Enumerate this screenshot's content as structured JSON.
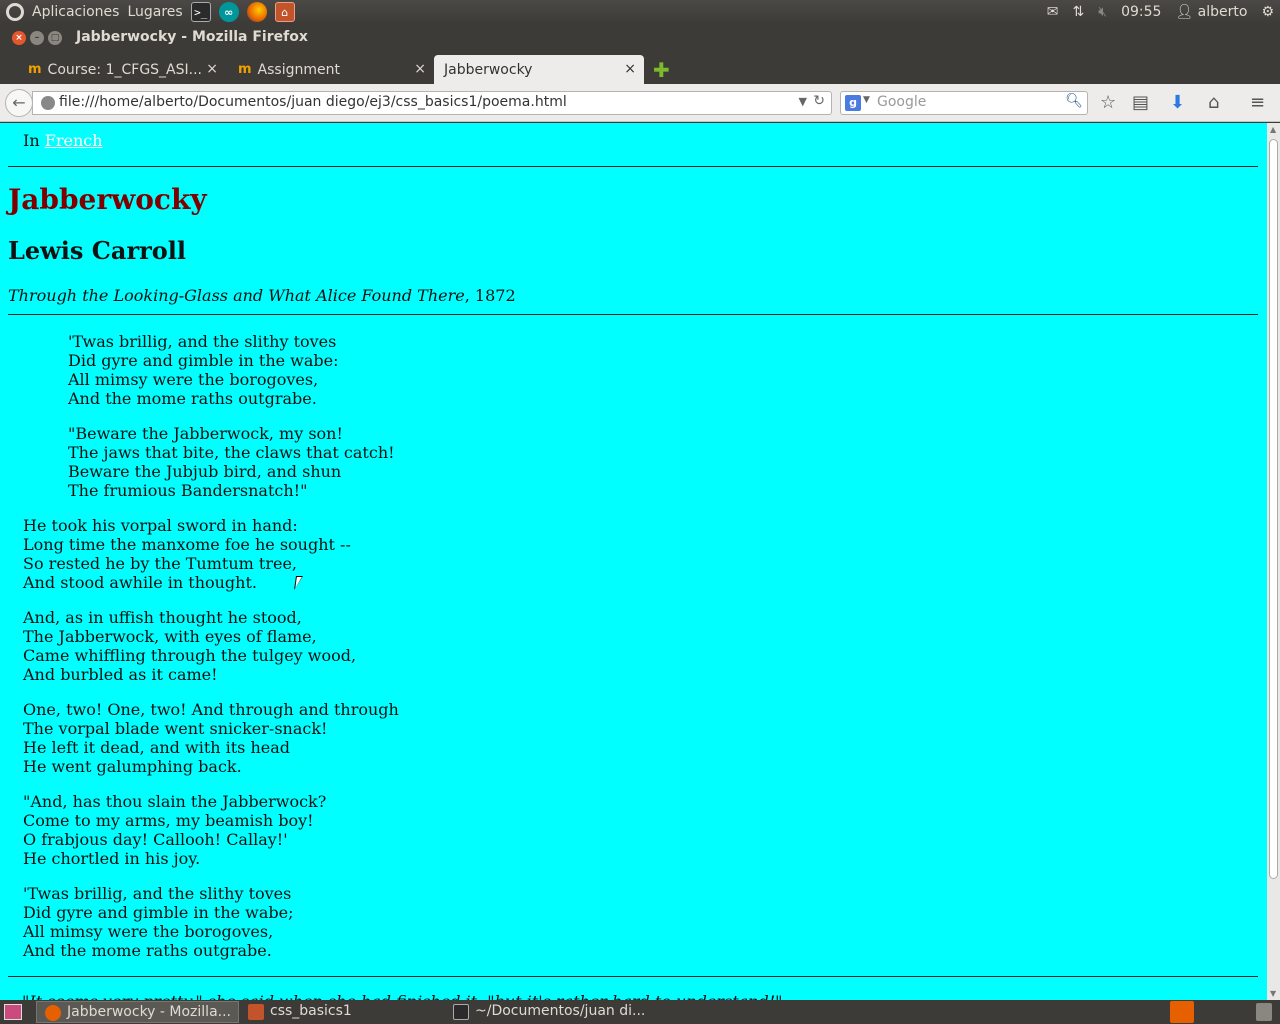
{
  "panel": {
    "menu_apps": "Aplicaciones",
    "menu_places": "Lugares",
    "clock": "09:55",
    "user": "alberto",
    "icons": [
      "terminal-icon",
      "arduino-icon",
      "firefox-icon",
      "home-folder-icon",
      "mail-icon",
      "network-icon",
      "volume-muted-icon",
      "user-icon",
      "gear-icon"
    ]
  },
  "window": {
    "title": "Jabberwocky - Mozilla Firefox"
  },
  "tabs": [
    {
      "label": "Course: 1_CFGS_ASI...",
      "active": false
    },
    {
      "label": "Assignment",
      "active": false
    },
    {
      "label": "Jabberwocky",
      "active": true
    }
  ],
  "tab_close": "×",
  "navbar": {
    "url": "file:///home/alberto/Documentos/juan diego/ej3/css_basics1/poema.html",
    "search_placeholder": "Google",
    "search_engine": "g"
  },
  "page": {
    "lang_prefix": "In",
    "lang_link": "French",
    "title": "Jabberwocky",
    "author": "Lewis Carroll",
    "source_italic": "Through the Looking-Glass and What Alice Found There",
    "source_year": ", 1872",
    "stanzas": [
      [
        "'Twas brillig, and the slithy toves",
        "Did gyre and gimble in the wabe:",
        "All mimsy were the borogoves,",
        "And the mome raths outgrabe."
      ],
      [
        "\"Beware the Jabberwock, my son!",
        "The jaws that bite, the claws that catch!",
        "Beware the Jubjub bird, and shun",
        "The frumious Bandersnatch!\""
      ],
      [
        "He took his vorpal sword in hand:",
        "Long time the manxome foe he sought --",
        "So rested he by the Tumtum tree,",
        "And stood awhile in thought."
      ],
      [
        "And, as in uffish thought he stood,",
        "The Jabberwock, with eyes of flame,",
        "Came whiffling through the tulgey wood,",
        "And burbled as it came!"
      ],
      [
        "One, two! One, two! And through and through",
        "The vorpal blade went snicker-snack!",
        "He left it dead, and with its head",
        "He went galumphing back."
      ],
      [
        "\"And, has thou slain the Jabberwock?",
        "Come to my arms, my beamish boy!",
        "O frabjous day! Callooh! Callay!'",
        "He chortled in his joy."
      ],
      [
        "'Twas brillig, and the slithy toves",
        "Did gyre and gimble in the wabe;",
        "All mimsy were the borogoves,",
        "And the mome raths outgrabe."
      ]
    ],
    "footer_partial": "\"It seems very pretty,\" she said when she had finished it, \"but it's rather hard to understand!\""
  },
  "taskbar": {
    "items": [
      {
        "label": "Jabberwocky - Mozilla...",
        "active": true
      },
      {
        "label": "css_basics1",
        "active": false
      },
      {
        "label": "~/Documentos/juan di...",
        "active": false
      }
    ]
  },
  "colors": {
    "page_bg": "#00ffff",
    "heading": "#800000",
    "link": "#ffffff"
  }
}
